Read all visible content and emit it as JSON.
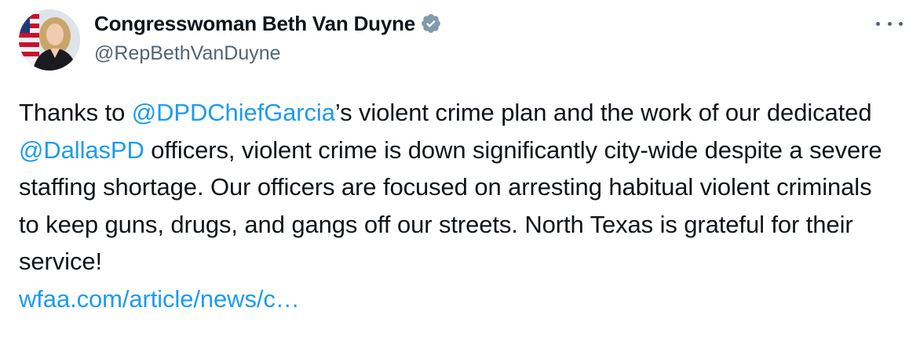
{
  "author": {
    "display_name": "Congresswoman Beth Van Duyne",
    "handle": "@RepBethVanDuyne",
    "verified_badge_color": "#829aab"
  },
  "menu": {
    "more_icon": "ellipsis-horizontal-icon"
  },
  "tweet": {
    "text_1": "Thanks to ",
    "mention_1": "@DPDChiefGarcia",
    "text_2": "’s violent crime plan and the work of our dedicated ",
    "mention_2": "@DallasPD",
    "text_3": " officers, violent crime is down significantly city-wide despite a severe staffing shortage. Our officers are focused on arresting habitual violent criminals to keep guns, drugs, and gangs off our streets. North Texas is grateful for their service!",
    "link_text": "wfaa.com/article/news/c…"
  },
  "colors": {
    "link": "#1d9bf0",
    "text": "#0f1419",
    "secondary": "#536471"
  }
}
